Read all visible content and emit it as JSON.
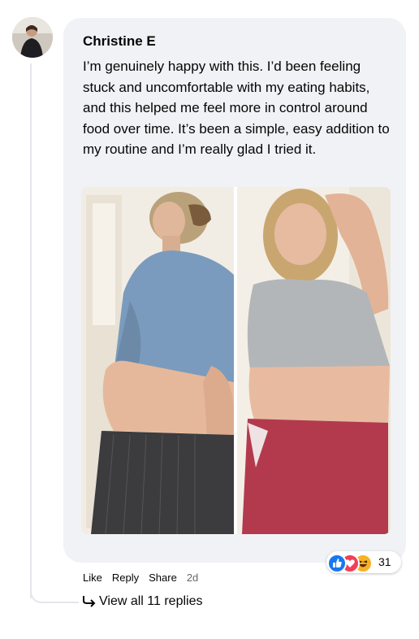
{
  "comment": {
    "author": "Christine E",
    "text": "I’m genuinely happy with this. I’d been feeling stuck and uncomfortable with my eating habits, and this helped me feel more in control around food over time. It’s been a simple, easy addition to my routine and I’m really glad I tried it.",
    "photo_icon": "before-after-photo",
    "reactions": {
      "icons": [
        "like-icon",
        "love-icon",
        "haha-icon"
      ],
      "count": "31"
    },
    "actions": {
      "like": "Like",
      "reply": "Reply",
      "share": "Share",
      "time": "2d"
    },
    "view_replies": "View all 11 replies"
  },
  "colors": {
    "bubble": "#f0f2f5",
    "like": "#1877f2",
    "love": "#f33e58",
    "haha": "#f7b125",
    "meta": "#65676b"
  }
}
